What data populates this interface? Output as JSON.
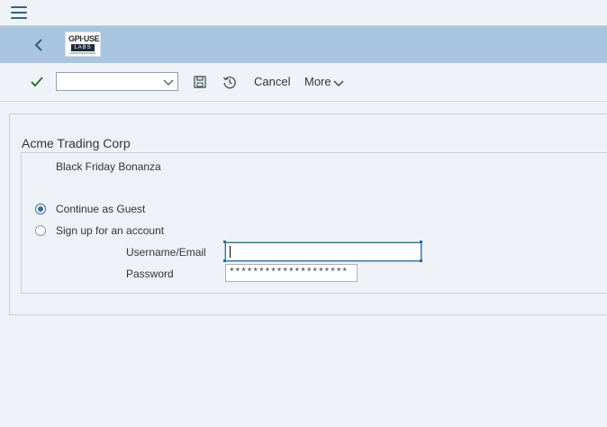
{
  "toolbar": {
    "cancel_label": "Cancel",
    "more_label": "More",
    "combo_value": ""
  },
  "logo": {
    "text": "GPI·USE",
    "sub": "LABS"
  },
  "form": {
    "company": "Acme Trading Corp",
    "promo": "Black Friday Bonanza",
    "options": [
      {
        "label": "Continue as Guest",
        "selected": true
      },
      {
        "label": "Sign up for an account",
        "selected": false
      }
    ],
    "username_label": "Username/Email",
    "username_value": "",
    "password_label": "Password",
    "password_value": "********************"
  },
  "colors": {
    "shell": "#a9c4df",
    "accent": "#3a6795",
    "confirm": "#2b7d2b"
  }
}
